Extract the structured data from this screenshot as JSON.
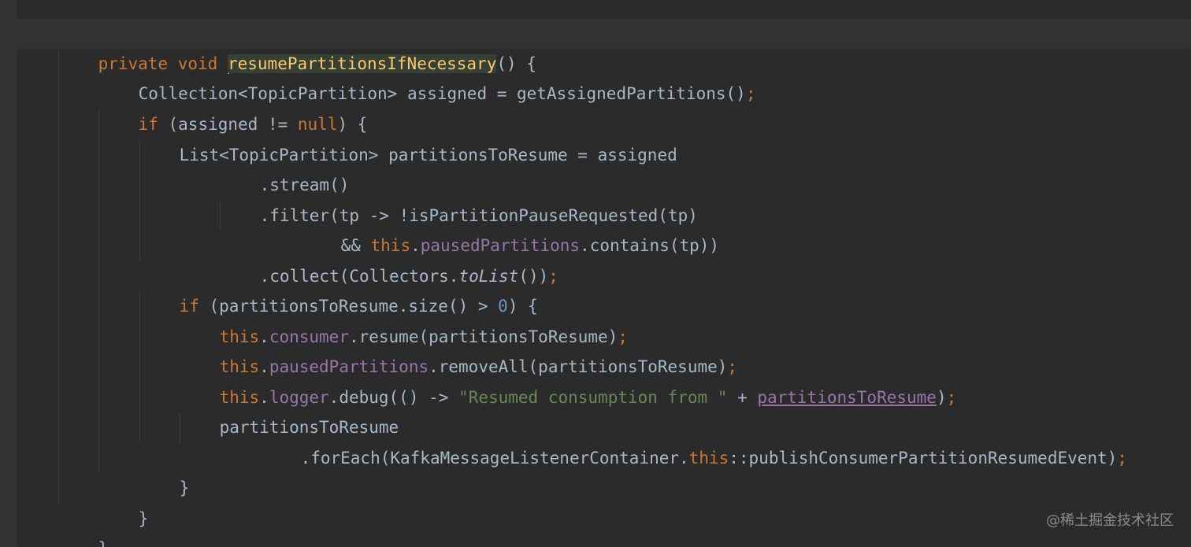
{
  "code": {
    "l1": {
      "kw1": "private",
      "kw2": "void",
      "method": "resumePartitionsIfNecessary",
      "rest": "() {"
    },
    "l2": {
      "text": "Collection<TopicPartition> assigned = getAssignedPartitions()",
      "semi": ";"
    },
    "l3": {
      "kw": "if",
      "mid": " (assigned != ",
      "nullkw": "null",
      "rest": ") {"
    },
    "l4": {
      "text": "List<TopicPartition> partitionsToResume = assigned"
    },
    "l5": {
      "text": ".stream()"
    },
    "l6": {
      "text": ".filter(tp -> !isPartitionPauseRequested(tp)"
    },
    "l7": {
      "amp": "&& ",
      "thiskw": "this",
      "dot": ".",
      "field": "pausedPartitions",
      "rest": ".contains(tp))"
    },
    "l8": {
      "pre": ".collect(Collectors.",
      "static": "toList",
      "post": "())",
      "semi": ";"
    },
    "l9": {
      "kw": "if",
      "mid": " (partitionsToResume.size() > ",
      "num": "0",
      "rest": ") {"
    },
    "l10": {
      "thiskw": "this",
      "dot": ".",
      "field": "consumer",
      "rest": ".resume(partitionsToResume)",
      "semi": ";"
    },
    "l11": {
      "thiskw": "this",
      "dot": ".",
      "field": "pausedPartitions",
      "rest": ".removeAll(partitionsToResume)",
      "semi": ";"
    },
    "l12": {
      "thiskw": "this",
      "dot": ".",
      "field": "logger",
      "mid": ".debug(() -> ",
      "str": "\"Resumed consumption from \"",
      "plus": " + ",
      "var": "partitionsToResume",
      "close": ")",
      "semi": ";"
    },
    "l13": {
      "text": "partitionsToResume"
    },
    "l14": {
      "pre": ".forEach(KafkaMessageListenerContainer.",
      "thiskw": "this",
      "post": "::publishConsumerPartitionResumedEvent)",
      "semi": ";"
    },
    "l15": {
      "text": "}"
    },
    "l16": {
      "text": "}"
    },
    "l17": {
      "text": "}"
    }
  },
  "watermark": "@稀土掘金技术社区",
  "colors": {
    "background": "#2b2b2b",
    "current_line": "#323232",
    "keyword": "#cc7832",
    "method_declaration": "#ffc66d",
    "field": "#9876aa",
    "number": "#6897bb",
    "string": "#6a8759",
    "default_text": "#a9b7c6"
  }
}
